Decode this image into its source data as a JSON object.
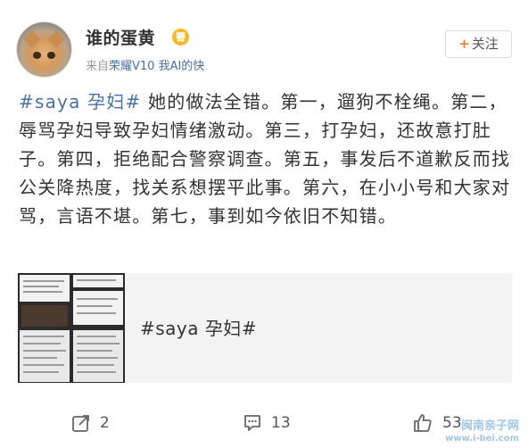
{
  "author": {
    "name": "谁的蛋黄",
    "vip_badge": "簪",
    "source_prefix": "来自",
    "source_device": "荣耀V10 我AI的快"
  },
  "follow_button": {
    "plus": "+",
    "label": "关注"
  },
  "post": {
    "hashtag": "#saya 孕妇#",
    "body": " 她的做法全错。第一，遛狗不栓绳。第二，辱骂孕妇导致孕妇情绪激动。第三，打孕妇，还故意打肚子。第四，拒绝配合警察调查。第五，事发后不道歉反而找公关降热度，找关系想摆平此事。第六，在小小号和大家对骂，言语不堪。第七，事到如今依旧不知错。"
  },
  "link_card": {
    "title": "#saya 孕妇#"
  },
  "actions": {
    "repost_count": "2",
    "comment_count": "13",
    "like_count": "53"
  },
  "watermark": {
    "line1": "闽南亲子网",
    "line2": "www.i-bei.com"
  },
  "colors": {
    "link_blue": "#4a6fa5",
    "follow_orange": "#f07d34",
    "badge_gold": "#f5b923"
  }
}
